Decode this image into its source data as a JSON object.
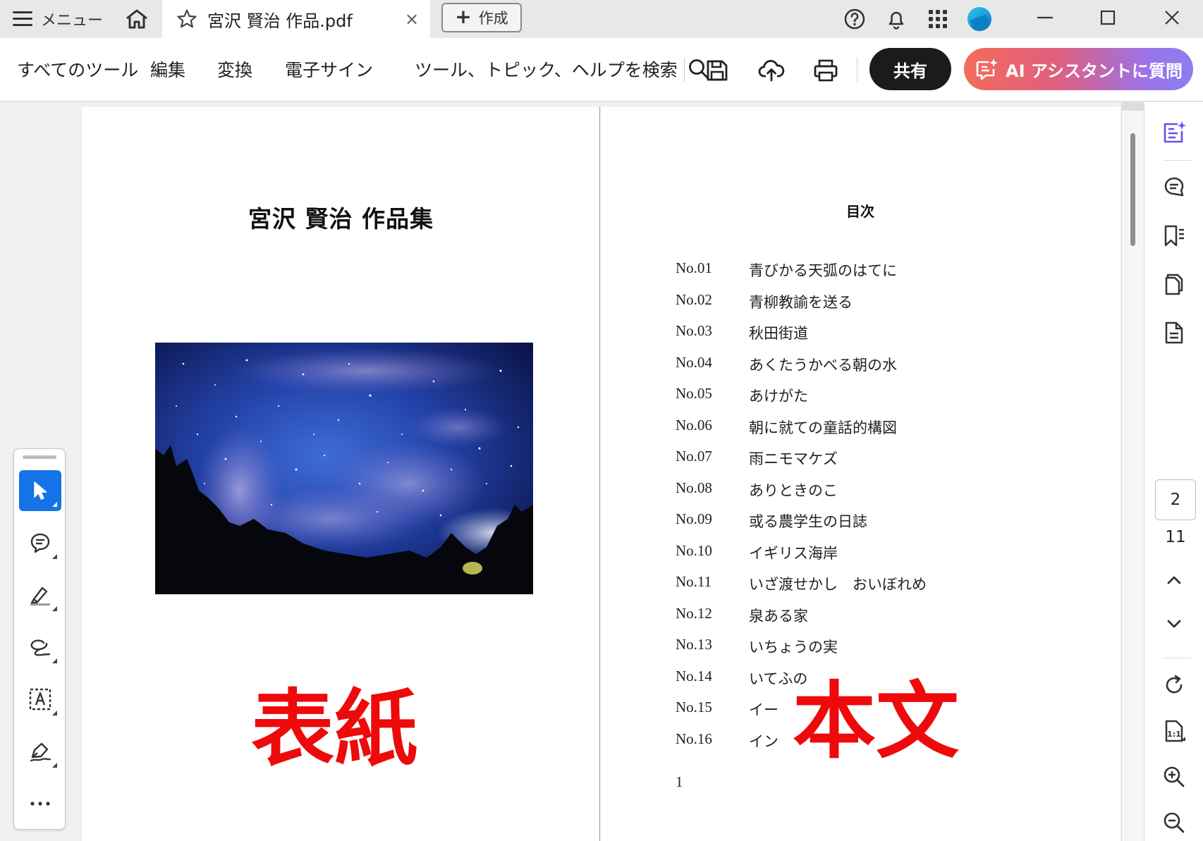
{
  "titlebar": {
    "menu_label": "メニュー",
    "tab_title": "宮沢 賢治 作品.pdf",
    "tab_close": "×",
    "new_button_label": "作成"
  },
  "toolbar": {
    "all_tools": "すべてのツール",
    "edit": "編集",
    "convert": "変換",
    "esign": "電子サイン",
    "search_placeholder": "ツール、トピック、ヘルプを検索",
    "share": "共有",
    "ai_assistant": "AI アシスタントに質問"
  },
  "document": {
    "cover": {
      "title": "宮沢 賢治 作品集",
      "annotation": "表紙"
    },
    "body": {
      "toc_heading": "目次",
      "annotation": "本文",
      "page_number": "1",
      "toc": [
        {
          "no": "No.01",
          "title": "青びかる天弧のはてに"
        },
        {
          "no": "No.02",
          "title": "青柳教諭を送る"
        },
        {
          "no": "No.03",
          "title": "秋田街道"
        },
        {
          "no": "No.04",
          "title": "あくたうかべる朝の水"
        },
        {
          "no": "No.05",
          "title": "あけがた"
        },
        {
          "no": "No.06",
          "title": "朝に就ての童話的構図"
        },
        {
          "no": "No.07",
          "title": "雨ニモマケズ"
        },
        {
          "no": "No.08",
          "title": "ありときのこ"
        },
        {
          "no": "No.09",
          "title": "或る農学生の日誌"
        },
        {
          "no": "No.10",
          "title": "イギリス海岸"
        },
        {
          "no": "No.11",
          "title": "いざ渡せかし　おいぼれめ"
        },
        {
          "no": "No.12",
          "title": "泉ある家"
        },
        {
          "no": "No.13",
          "title": "いちょうの実"
        },
        {
          "no": "No.14",
          "title": "いてふの"
        },
        {
          "no": "No.15",
          "title": "イー"
        },
        {
          "no": "No.16",
          "title": "イン"
        }
      ]
    }
  },
  "navigation": {
    "current_page": "2",
    "total_pages": "11"
  },
  "colors": {
    "accent": "#1473e6",
    "annotation_red": "#ee0a0a",
    "share_bg": "#1b1b1b"
  }
}
